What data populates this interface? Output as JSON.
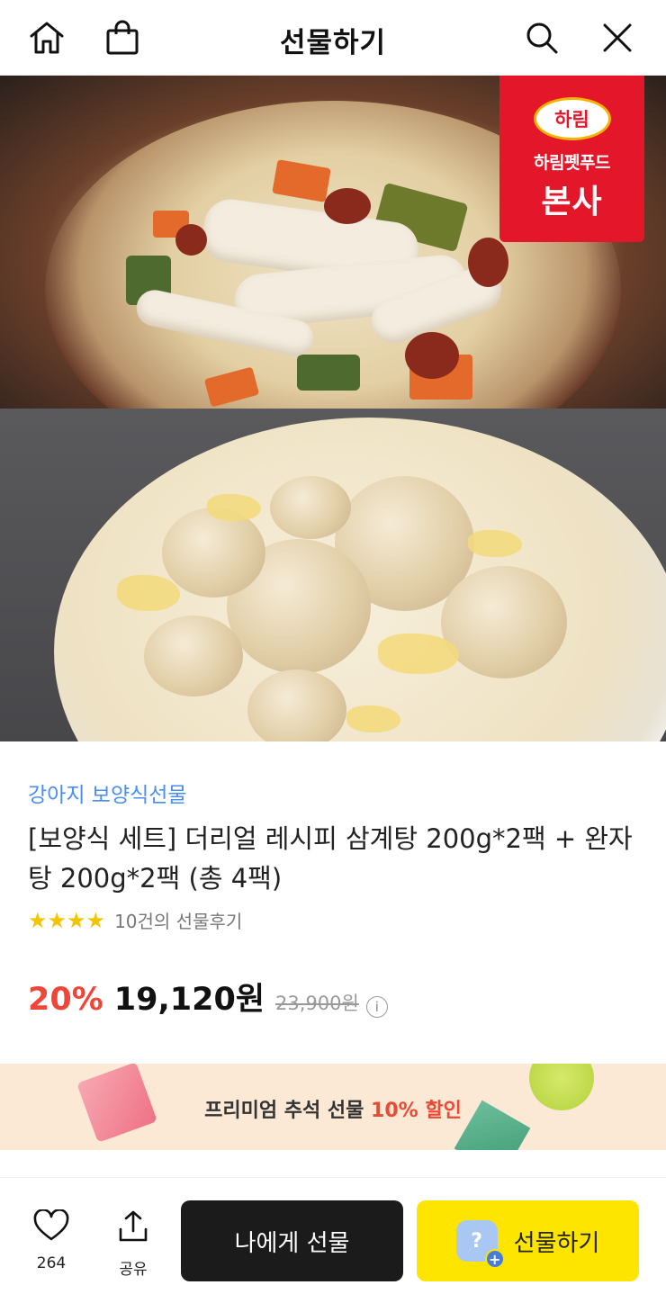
{
  "header": {
    "title": "선물하기",
    "icons": [
      "home-icon",
      "shopping-bag-icon",
      "search-icon",
      "close-icon"
    ]
  },
  "hero": {
    "badge": {
      "logo_text": "하림",
      "subtitle": "하림펫푸드",
      "main": "본사"
    },
    "slide_count": 3,
    "active_slide": 1
  },
  "product": {
    "category": "강아지 보양식선물",
    "title": "[보양식 세트] 더리얼 레시피 삼계탕 200g*2팩 + 완자탕 200g*2팩 (총 4팩)",
    "stars": "★★★★",
    "review_text": "10건의 선물후기",
    "discount": "20%",
    "sale_price": "19,120원",
    "original_price": "23,900원",
    "info_icon": "i"
  },
  "banner": {
    "text_before": "프리미엄 추석 선물 ",
    "highlight": "10% 할인"
  },
  "bottom": {
    "like_count": "264",
    "share_label": "공유",
    "self_gift_label": "나에게 선물",
    "gift_label": "선물하기",
    "gift_icon_glyph": "?",
    "gift_plus_glyph": "+"
  },
  "colors": {
    "accent_red": "#f0463a",
    "category_blue": "#4a8ef0",
    "gift_button_yellow": "#fee500",
    "self_button_black": "#1b1b1b",
    "brand_red": "#e3162a",
    "banner_bg": "#fbe9d6",
    "star_yellow": "#f5c400"
  }
}
